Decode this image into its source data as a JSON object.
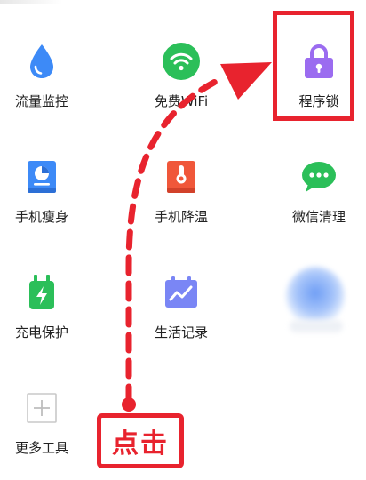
{
  "tools": [
    {
      "id": "traffic",
      "label": "流量监控",
      "icon": "water-drop-icon",
      "color": "#3d8af7"
    },
    {
      "id": "wifi",
      "label": "免费WiFi",
      "icon": "wifi-icon",
      "color": "#2bbf59"
    },
    {
      "id": "applock",
      "label": "程序锁",
      "icon": "lock-icon",
      "color": "#9b6cf0"
    },
    {
      "id": "slim",
      "label": "手机瘦身",
      "icon": "storage-pie-icon",
      "color": "#3d8af7"
    },
    {
      "id": "cool",
      "label": "手机降温",
      "icon": "thermometer-icon",
      "color": "#f0573a"
    },
    {
      "id": "wechat",
      "label": "微信清理",
      "icon": "wechat-icon",
      "color": "#2bbf59"
    },
    {
      "id": "charge",
      "label": "充电保护",
      "icon": "battery-icon",
      "color": "#2bbf59"
    },
    {
      "id": "record",
      "label": "生活记录",
      "icon": "calendar-chart-icon",
      "color": "#7a86f5"
    },
    {
      "id": "more",
      "label": "更多工具",
      "icon": "plus-icon",
      "color": "#bdbdbd"
    }
  ],
  "callout": {
    "text": "点击"
  },
  "colors": {
    "accent": "#e8232e"
  }
}
